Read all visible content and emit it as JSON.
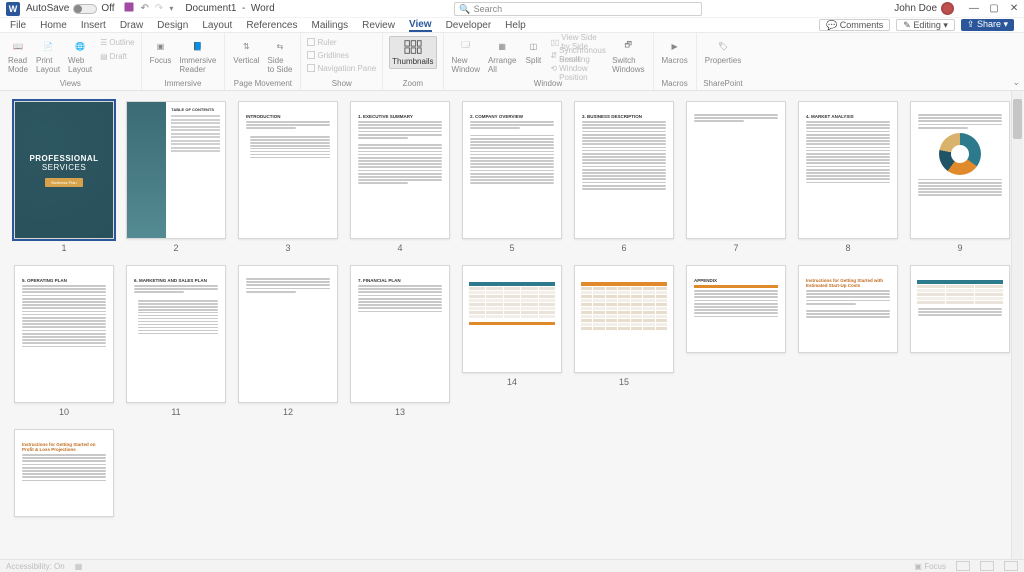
{
  "titlebar": {
    "autosave_label": "AutoSave",
    "autosave_state": "Off",
    "doc_name": "Document1",
    "app_name": "Word",
    "search_placeholder": "Search",
    "user_name": "John Doe"
  },
  "tabs": {
    "items": [
      "File",
      "Home",
      "Insert",
      "Draw",
      "Design",
      "Layout",
      "References",
      "Mailings",
      "Review",
      "View",
      "Developer",
      "Help"
    ],
    "active": "View",
    "comments": "Comments",
    "editing": "Editing",
    "share": "Share"
  },
  "ribbon": {
    "views": {
      "label": "Views",
      "read_mode": "Read\nMode",
      "print_layout": "Print\nLayout",
      "web_layout": "Web\nLayout",
      "outline": "Outline",
      "draft": "Draft"
    },
    "immersive": {
      "label": "Immersive",
      "focus": "Focus",
      "immersive_reader": "Immersive\nReader"
    },
    "page_movement": {
      "label": "Page Movement",
      "vertical": "Vertical",
      "side": "Side\nto Side"
    },
    "show": {
      "label": "Show",
      "ruler": "Ruler",
      "gridlines": "Gridlines",
      "nav": "Navigation Pane"
    },
    "zoom": {
      "label": "Zoom",
      "thumbnails": "Thumbnails"
    },
    "window": {
      "label": "Window",
      "new": "New\nWindow",
      "arrange": "Arrange\nAll",
      "split": "Split",
      "sbs": "View Side by Side",
      "sync": "Synchronous Scrolling",
      "reset": "Reset Window Position",
      "switch": "Switch\nWindows"
    },
    "macros": {
      "label": "Macros",
      "macros": "Macros"
    },
    "sharepoint": {
      "label": "SharePoint",
      "properties": "Properties"
    }
  },
  "pages": {
    "cover": {
      "line1": "PROFESSIONAL",
      "line2": "SERVICES",
      "badge": "Business Plan"
    },
    "toc_title": "TABLE OF CONTENTS",
    "headings": {
      "p3": "INTRODUCTION",
      "p4": "1.  EXECUTIVE SUMMARY",
      "p5": "2.  COMPANY OVERVIEW",
      "p6": "3.  BUSINESS DESCRIPTION",
      "p8": "4.  MARKET ANALYSIS",
      "p10": "5.  OPERATING PLAN",
      "p11": "6.  MARKETING AND SALES PLAN",
      "p13": "7.  FINANCIAL PLAN",
      "p16": "APPENDIX",
      "p17": "Instructions for Getting Started with Estimated Start-Up Costs",
      "p19": "Instructions for Getting Started on Profit & Loss Projections"
    },
    "count": 19
  },
  "status": {
    "accessibility": "Accessibility: On",
    "focus": "Focus"
  }
}
